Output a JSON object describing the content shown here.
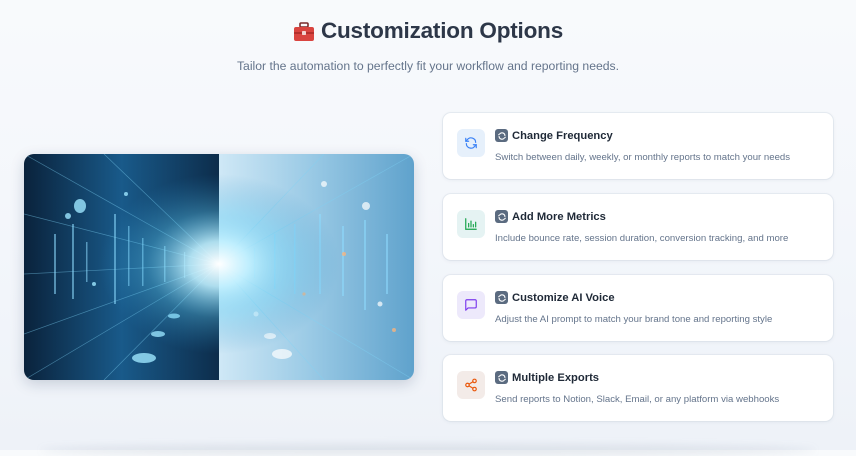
{
  "header": {
    "title": "Customization Options",
    "title_icon": "toolbox-icon",
    "subtitle": "Tailor the automation to perfectly fit your workflow and reporting needs."
  },
  "hero_image": {
    "description_icon": "data-tunnel-image"
  },
  "options": [
    {
      "icon": "refresh-icon",
      "icon_color": "#3b82f6",
      "icon_bg": "#e6f0fb",
      "title": "Change Frequency",
      "description": "Switch between daily, weekly, or monthly reports to match your needs"
    },
    {
      "icon": "bar-chart-icon",
      "icon_color": "#16a34a",
      "icon_bg": "#e5f3f3",
      "title": "Add More Metrics",
      "description": "Include bounce rate, session duration, conversion tracking, and more"
    },
    {
      "icon": "chat-bubble-icon",
      "icon_color": "#7c3aed",
      "icon_bg": "#ede9fb",
      "title": "Customize AI Voice",
      "description": "Adjust the AI prompt to match your brand tone and reporting style"
    },
    {
      "icon": "share-icon",
      "icon_color": "#ea580c",
      "icon_bg": "#f3ebe8",
      "title": "Multiple Exports",
      "description": "Send reports to Notion, Slack, Email, or any platform via webhooks"
    }
  ]
}
